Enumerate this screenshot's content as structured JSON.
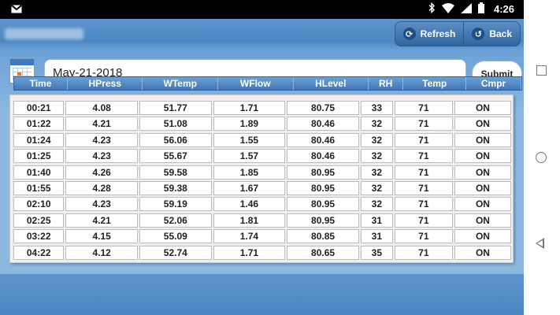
{
  "status": {
    "time": "4:26",
    "mail_icon": "gmail-icon"
  },
  "header": {
    "refresh_label": "Refresh",
    "back_label": "Back"
  },
  "date": {
    "value": "May-21-2018"
  },
  "submit_label": "Submit",
  "table": {
    "columns": [
      "Time",
      "HPress",
      "WTemp",
      "WFlow",
      "HLevel",
      "RH",
      "Temp",
      "Cmpr"
    ],
    "rows": [
      [
        "00:21",
        "4.08",
        "51.77",
        "1.71",
        "80.75",
        "33",
        "71",
        "ON"
      ],
      [
        "01:22",
        "4.21",
        "51.08",
        "1.89",
        "80.46",
        "32",
        "71",
        "ON"
      ],
      [
        "01:24",
        "4.23",
        "56.06",
        "1.55",
        "80.46",
        "32",
        "71",
        "ON"
      ],
      [
        "01:25",
        "4.23",
        "55.67",
        "1.57",
        "80.46",
        "32",
        "71",
        "ON"
      ],
      [
        "01:40",
        "4.26",
        "59.58",
        "1.85",
        "80.95",
        "32",
        "71",
        "ON"
      ],
      [
        "01:55",
        "4.28",
        "59.38",
        "1.67",
        "80.95",
        "32",
        "71",
        "ON"
      ],
      [
        "02:10",
        "4.23",
        "59.19",
        "1.46",
        "80.95",
        "32",
        "71",
        "ON"
      ],
      [
        "02:25",
        "4.21",
        "52.06",
        "1.81",
        "80.95",
        "31",
        "71",
        "ON"
      ],
      [
        "03:22",
        "4.15",
        "55.09",
        "1.74",
        "80.85",
        "31",
        "71",
        "ON"
      ],
      [
        "04:22",
        "4.12",
        "52.74",
        "1.71",
        "80.65",
        "35",
        "71",
        "ON"
      ]
    ]
  }
}
